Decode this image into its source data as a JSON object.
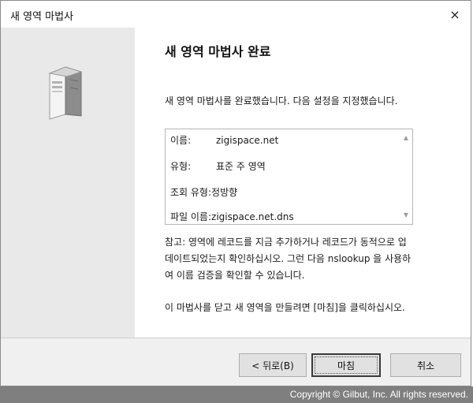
{
  "window": {
    "title": "새 영역 마법사",
    "close_glyph": "×"
  },
  "main": {
    "heading": "새 영역 마법사 완료",
    "description": "새 영역 마법사를 완료했습니다. 다음 설정을 지정했습니다.",
    "summary": [
      {
        "label": "이름:",
        "value": "zigispace.net"
      },
      {
        "label": "유형:",
        "value": "표준 주 영역"
      },
      {
        "label": "조회 유형:",
        "value": "정방향"
      },
      {
        "label": "파일 이름:",
        "value": "zigispace.net.dns"
      }
    ],
    "note_lines": [
      "참고: 영역에 레코드를 지금 추가하거나 레코드가 동적으로 업",
      "데이트되었는지 확인하십시오. 그런 다음 nslookup 을 사용하",
      "여 이름 검증을 확인할 수 있습니다."
    ],
    "finish_instruction": "이 마법사를 닫고 새 영역을 만들려면 [마침]을 클릭하십시오."
  },
  "buttons": {
    "back": "< 뒤로(B)",
    "finish": "마침",
    "cancel": "취소"
  },
  "icons": {
    "server": "server-icon",
    "close": "close-icon",
    "scroll_up": "scroll-up-icon",
    "scroll_down": "scroll-down-icon"
  },
  "copyright": "Copyright © Gilbut, Inc. All rights reserved."
}
